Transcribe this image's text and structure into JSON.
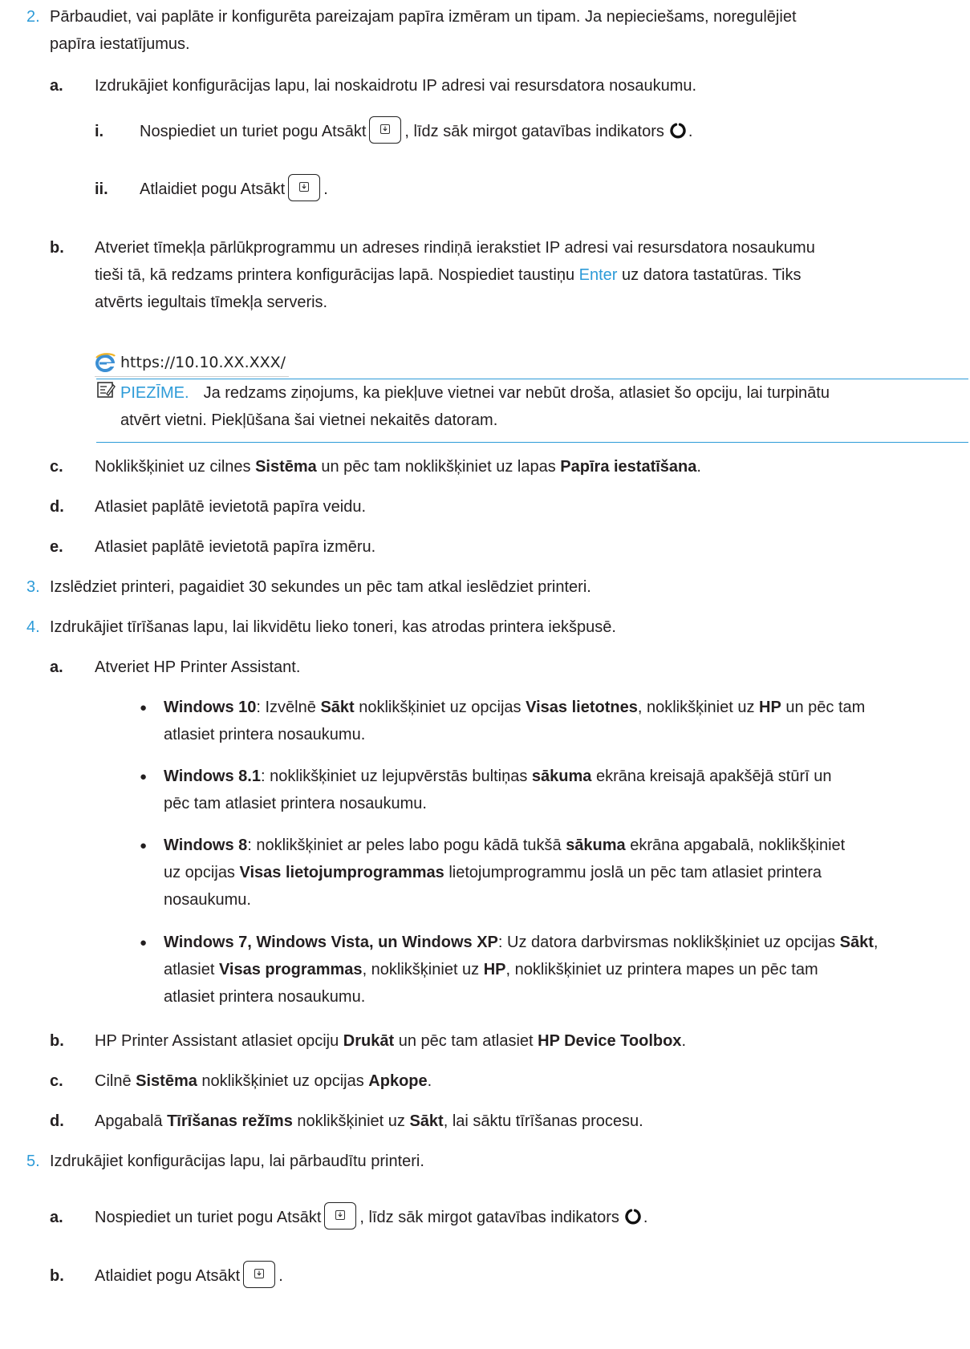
{
  "step2": {
    "num": "2.",
    "text": "Pārbaudiet, vai paplāte ir konfigurēta pareizajam papīra izmēram un tipam. Ja nepieciešams, noregulējiet",
    "text2": "papīra iestatījumus.",
    "a": {
      "num": "a.",
      "text": "Izdrukājiet konfigurācijas lapu, lai noskaidrotu IP adresi vai resursdatora nosaukumu."
    },
    "i": {
      "num": "i.",
      "pre": "Nospiediet un turiet pogu Atsākt",
      "post": ", līdz sāk mirgot gatavības indikators",
      "end": "."
    },
    "ii": {
      "num": "ii.",
      "pre": "Atlaidiet pogu Atsākt",
      "end": "."
    },
    "b": {
      "num": "b.",
      "line1": "Atveriet tīmekļa pārlūkprogrammu un adreses rindiņā ierakstiet IP adresi vai resursdatora nosaukumu",
      "line2_pre": "tieši tā, kā redzams printera konfigurācijas lapā. Nospiediet taustiņu ",
      "line2_link": "Enter",
      "line2_post": " uz datora tastatūras. Tiks",
      "line3": "atvērts iegultais tīmekļa serveris."
    },
    "url": "https://10.10.XX.XXX/",
    "note": {
      "title": "PIEZĪME.",
      "line1": "Ja redzams ziņojums, ka piekļuve vietnei var nebūt droša, atlasiet šo opciju, lai turpinātu",
      "line2": "atvērt vietni. Piekļūšana šai vietnei nekaitēs datoram."
    },
    "c": {
      "num": "c.",
      "pre": "Noklikšķiniet uz cilnes ",
      "b1": "Sistēma",
      "mid": " un pēc tam noklikšķiniet uz lapas ",
      "b2": "Papīra iestatīšana",
      "end": "."
    },
    "d": {
      "num": "d.",
      "text": "Atlasiet paplātē ievietotā papīra veidu."
    },
    "e": {
      "num": "e.",
      "text": "Atlasiet paplātē ievietotā papīra izmēru."
    }
  },
  "step3": {
    "num": "3.",
    "text": "Izslēdziet printeri, pagaidiet 30 sekundes un pēc tam atkal ieslēdziet printeri."
  },
  "step4": {
    "num": "4.",
    "text": "Izdrukājiet tīrīšanas lapu, lai likvidētu lieko toneri, kas atrodas printera iekšpusē.",
    "a": {
      "num": "a.",
      "text": "Atveriet HP Printer Assistant."
    },
    "bullets": {
      "win10": {
        "b1": "Windows 10",
        "t1": ": Izvēlnē ",
        "b2": "Sākt",
        "t2": " noklikšķiniet uz opcijas ",
        "b3": "Visas lietotnes",
        "t3": ", noklikšķiniet uz ",
        "b4": "HP",
        "t4": " un pēc tam",
        "line2": "atlasiet printera nosaukumu."
      },
      "win81": {
        "b1": "Windows 8.1",
        "t1": ": noklikšķiniet uz lejupvērstās bultiņas ",
        "b2": "sākuma",
        "t2": " ekrāna kreisajā apakšējā stūrī un",
        "line2": "pēc tam atlasiet printera nosaukumu."
      },
      "win8": {
        "b1": "Windows 8",
        "t1": ": noklikšķiniet ar peles labo pogu kādā tukšā ",
        "b2": "sākuma",
        "t2": " ekrāna apgabalā, noklikšķiniet",
        "l2a": "uz opcijas ",
        "l2b": "Visas lietojumprogrammas",
        "l2c": " lietojumprogrammu joslā un pēc tam atlasiet printera",
        "line3": "nosaukumu."
      },
      "win7": {
        "b1": "Windows 7, Windows Vista, un Windows XP",
        "t1": ": Uz datora darbvirsmas noklikšķiniet uz opcijas ",
        "b2": "Sākt",
        "t2": ",",
        "l2a": "atlasiet ",
        "l2b": "Visas programmas",
        "l2c": ", noklikšķiniet uz ",
        "l2d": "HP",
        "l2e": ", noklikšķiniet uz printera mapes un pēc tam",
        "line3": "atlasiet printera nosaukumu."
      }
    },
    "b": {
      "num": "b.",
      "pre": "HP Printer Assistant atlasiet opciju ",
      "b1": "Drukāt",
      "mid": " un pēc tam atlasiet ",
      "b2": "HP Device Toolbox",
      "end": "."
    },
    "c": {
      "num": "c.",
      "pre": "Cilnē ",
      "b1": "Sistēma",
      "mid": " noklikšķiniet uz opcijas ",
      "b2": "Apkope",
      "end": "."
    },
    "d": {
      "num": "d.",
      "pre": "Apgabalā ",
      "b1": "Tīrīšanas režīms",
      "mid": " noklikšķiniet uz ",
      "b2": "Sākt",
      "end": ", lai sāktu tīrīšanas procesu."
    }
  },
  "step5": {
    "num": "5.",
    "text": "Izdrukājiet konfigurācijas lapu, lai pārbaudītu printeri.",
    "a": {
      "num": "a.",
      "pre": "Nospiediet un turiet pogu Atsākt",
      "post": ", līdz sāk mirgot gatavības indikators",
      "end": "."
    },
    "b": {
      "num": "b.",
      "pre": "Atlaidiet pogu Atsākt",
      "end": "."
    }
  },
  "colors": {
    "accent": "#2d9bd8",
    "text": "#231f20"
  },
  "icons": {
    "resume_button": "resume-button-icon",
    "ready_light": "ready-light-icon",
    "browser": "browser-icon",
    "note": "note-icon"
  }
}
